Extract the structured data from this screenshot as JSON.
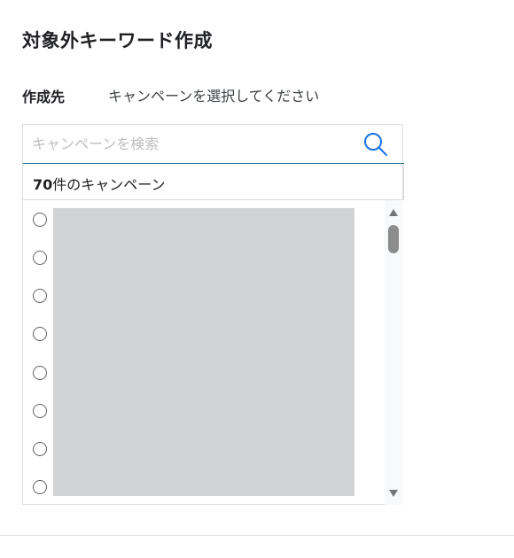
{
  "dialog": {
    "title": "対象外キーワード作成"
  },
  "destination": {
    "label": "作成先",
    "value": "キャンペーンを選択してください"
  },
  "search": {
    "placeholder": "キャンペーンを検索",
    "value": ""
  },
  "results": {
    "count": "70",
    "suffix": "件のキャンペーン"
  },
  "list": {
    "items": [
      "",
      "",
      "",
      "",
      "",
      "",
      "",
      ""
    ]
  },
  "colors": {
    "accent": "#1a73e8",
    "redaction": "#d2d3d5"
  },
  "icons": {
    "search": "search-icon",
    "radio": "radio-button-unchecked"
  }
}
